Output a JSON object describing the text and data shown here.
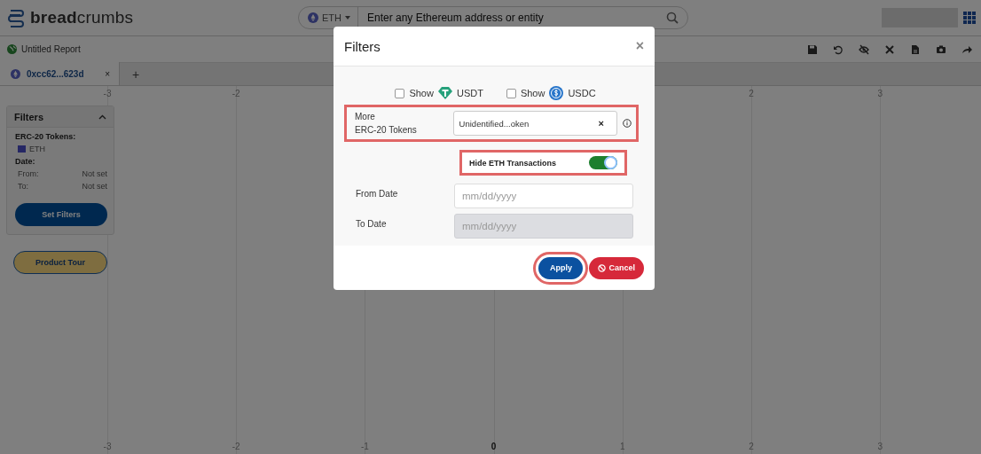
{
  "header": {
    "logo": "**bread**crumbs",
    "chain": "ETH",
    "search_placeholder": "Enter any Ethereum address or entity"
  },
  "report": {
    "title": "Untitled Report"
  },
  "tabs": [
    {
      "label": "0xcc62...623d",
      "selected": true,
      "close": "×"
    }
  ],
  "add_tab": "+",
  "sidebar": {
    "title": "Filters",
    "expanded": true,
    "tokens_label": "ERC-20 Tokens:",
    "tokens": [
      {
        "name": "ETH"
      }
    ],
    "date_label": "Date:",
    "dates": [
      {
        "label": "From:",
        "value": "Not set"
      },
      {
        "label": "To:",
        "value": "Not set"
      }
    ],
    "set_button": "Set Filters",
    "tour_button": "Product Tour"
  },
  "axis": {
    "top": [
      {
        "label": "-3"
      },
      {
        "label": "-2"
      },
      {
        "label": "2"
      },
      {
        "label": "3"
      }
    ],
    "bottom": [
      {
        "label": "-3",
        "emphasized": false
      },
      {
        "label": "-2",
        "emphasized": false
      },
      {
        "label": "-1",
        "emphasized": false
      },
      {
        "label": "0",
        "emphasized": true
      },
      {
        "label": "1",
        "emphasized": false
      },
      {
        "label": "2",
        "emphasized": false
      },
      {
        "label": "3",
        "emphasized": false
      }
    ]
  },
  "modal": {
    "title": "Filters",
    "close": "×",
    "show_tokens": [
      {
        "prefix": "Show",
        "token": "USDT",
        "checked": false,
        "kind": "tether"
      },
      {
        "prefix": "Show",
        "token": "USDC",
        "checked": false,
        "kind": "usdc"
      }
    ],
    "more_tokens": {
      "label": "More\nERC-20 Tokens",
      "value": "Unidentified...oken",
      "clear": "×",
      "highlighted": true
    },
    "hide_eth": {
      "label": "Hide ETH Transactions",
      "on": true,
      "highlighted": true
    },
    "dates": [
      {
        "label": "From Date",
        "placeholder": "mm/dd/yyyy",
        "disabled": false
      },
      {
        "label": "To Date",
        "placeholder": "mm/dd/yyyy",
        "disabled": true
      }
    ],
    "apply": {
      "label": "Apply",
      "highlighted": true
    },
    "cancel": {
      "label": "Cancel"
    }
  }
}
